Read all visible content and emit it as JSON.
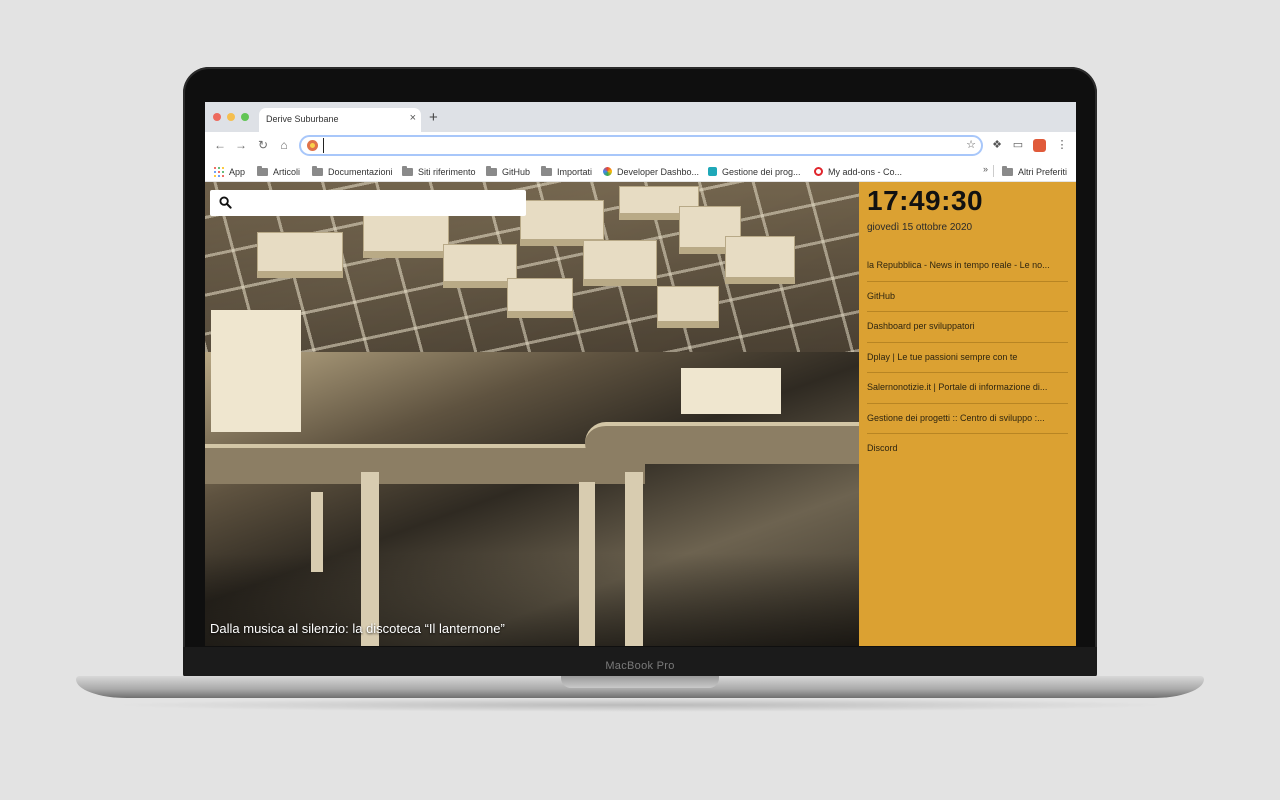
{
  "browser": {
    "tab_title": "Derive Suburbane",
    "tab_close": "×",
    "new_tab": "+",
    "address_value": "",
    "bookmarks": [
      {
        "label": "App",
        "icon": "apps-grid-icon"
      },
      {
        "label": "Articoli",
        "icon": "folder-icon"
      },
      {
        "label": "Documentazioni",
        "icon": "folder-icon"
      },
      {
        "label": "Siti riferimento",
        "icon": "folder-icon"
      },
      {
        "label": "GitHub",
        "icon": "folder-icon"
      },
      {
        "label": "Importati",
        "icon": "folder-icon"
      },
      {
        "label": "Developer Dashbo...",
        "icon": "rainbow-icon"
      },
      {
        "label": "Gestione dei prog...",
        "icon": "teal-star-icon"
      },
      {
        "label": "My add-ons - Co...",
        "icon": "opera-icon"
      }
    ],
    "bookmarks_more": "»",
    "other_bookmarks": "Altri Preferiti"
  },
  "page": {
    "search_placeholder": "",
    "caption": "Dalla musica al silenzio: la discoteca “Il lanternone”",
    "clock": "17:49:30",
    "date": "giovedì 15 ottobre 2020",
    "links": [
      "la Repubblica - News in tempo reale - Le no...",
      "GitHub",
      "Dashboard per sviluppatori",
      "Dplay | Le tue passioni sempre con te",
      "Salernonotizie.it | Portale di informazione di...",
      "Gestione dei progetti :: Centro di sviluppo :...",
      "Discord"
    ]
  },
  "laptop": {
    "model": "MacBook Pro"
  },
  "colors": {
    "sidebar": "#dba132",
    "tabstrip": "#dee1e6",
    "omnibox_border": "#a8c7fa"
  }
}
